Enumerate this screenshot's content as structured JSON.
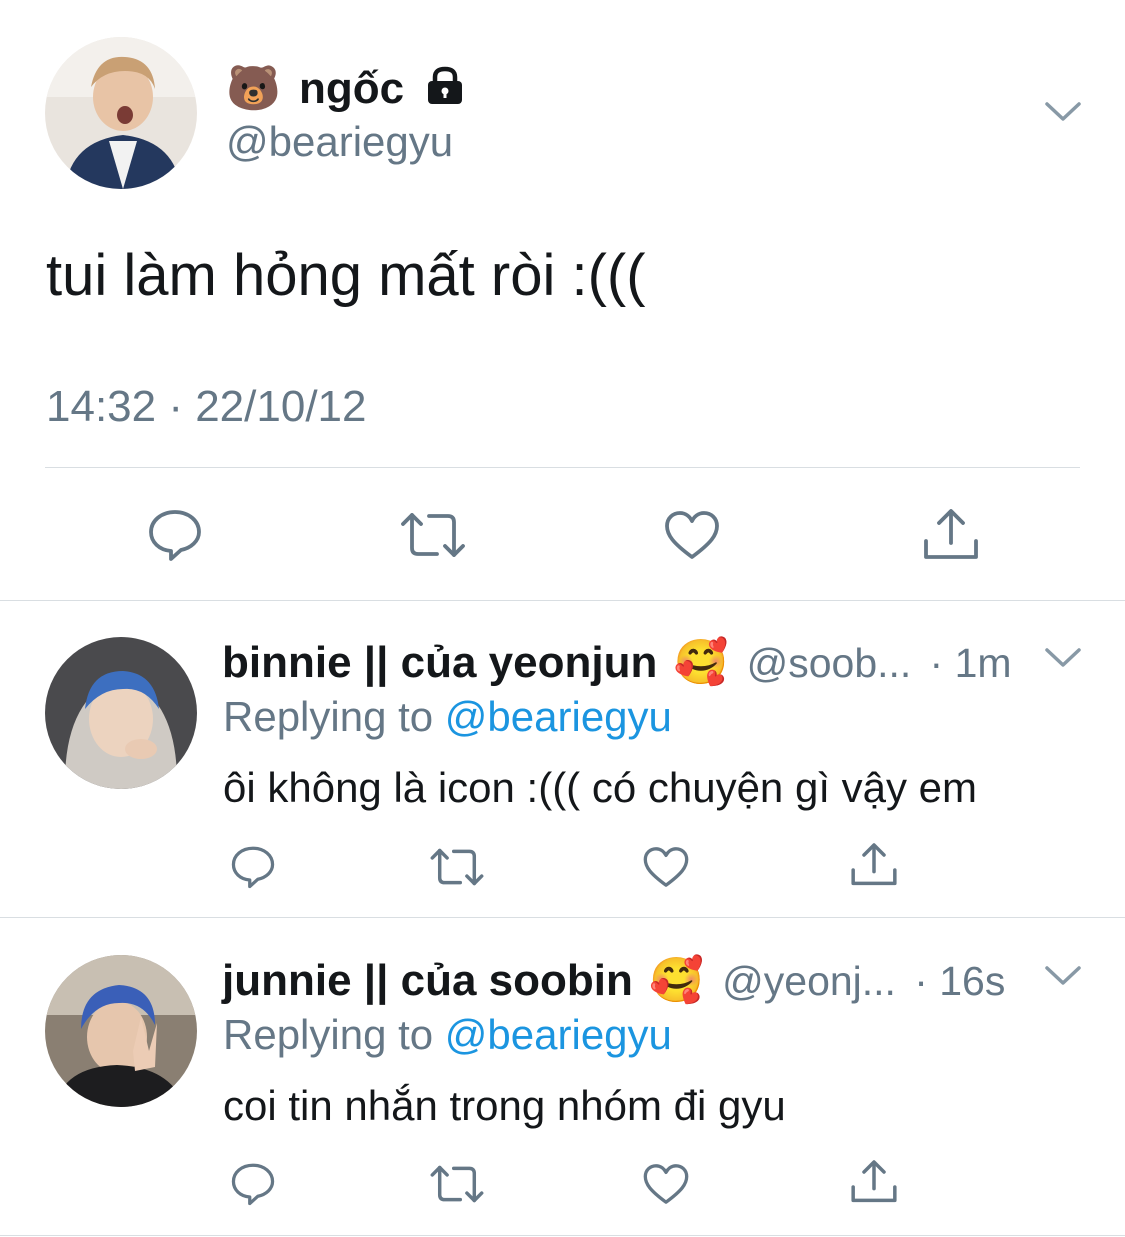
{
  "main_tweet": {
    "display_name": "ngốc",
    "name_emoji": "🐻",
    "protected_icon": "lock-icon",
    "handle": "@beariegyu",
    "text": "tui làm hỏng mất ròi :(((",
    "timestamp": "14:32 · 22/10/12",
    "actions": [
      "reply-icon",
      "retweet-icon",
      "like-icon",
      "share-icon"
    ]
  },
  "replies": [
    {
      "display_name": "binnie || của yeonjun",
      "name_emoji": "🥰",
      "handle": "@soob...",
      "time": "· 1m",
      "replying_prefix": "Replying to",
      "replying_to": "@beariegyu",
      "text": "ôi không là icon :((( có chuyện gì vậy em"
    },
    {
      "display_name": "junnie || của soobin",
      "name_emoji": "🥰",
      "handle": "@yeonj...",
      "time": "· 16s",
      "replying_prefix": "Replying to",
      "replying_to": "@beariegyu",
      "text": "coi tin nhắn trong nhóm đi gyu"
    }
  ],
  "colors": {
    "text": "#14171a",
    "secondary": "#657786",
    "link": "#1b95e0",
    "divider": "#d9dee2"
  }
}
